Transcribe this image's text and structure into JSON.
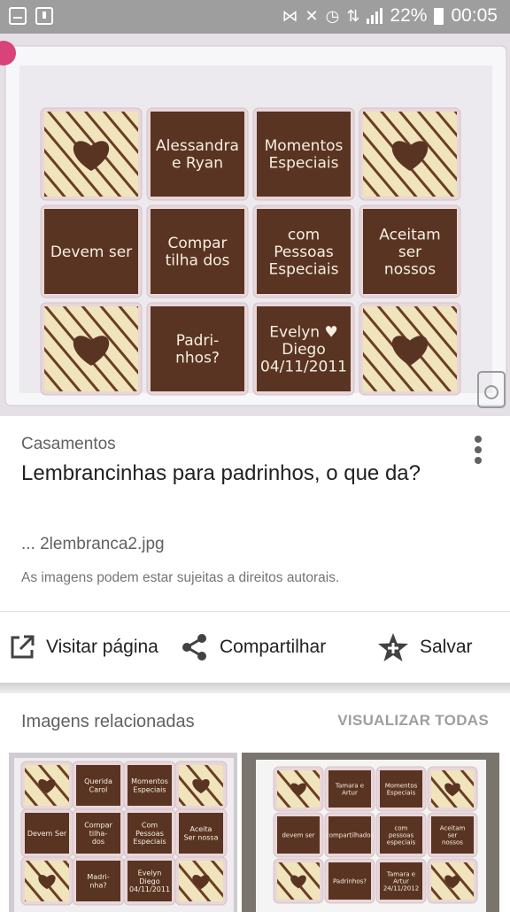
{
  "status_bar": {
    "battery_percent": "22%",
    "time": "00:05",
    "icons": [
      "screenshot-icon",
      "download-icon",
      "nfc-icon",
      "mute-icon",
      "alarm-icon",
      "data-icon",
      "signal-icon",
      "battery-icon"
    ]
  },
  "result": {
    "source": "Casamentos",
    "title": "Lembrancinhas para padrinhos, o que da?",
    "filename": "... 2lembranca2.jpg",
    "copyright": "As imagens podem estar sujeitas a direitos autorais."
  },
  "actions": {
    "visit": "Visitar página",
    "share": "Compartilhar",
    "save": "Salvar"
  },
  "related": {
    "title": "Imagens relacionadas",
    "view_all": "VISUALIZAR TODAS"
  },
  "hero_image": {
    "description_icon": "photo",
    "chocolate_texts": [
      [
        "",
        "Alessandra e Ryan",
        "Momentos Especiais",
        ""
      ],
      [
        "Devem ser",
        "Compar tilha dos",
        "com Pessoas Especiais",
        "Aceitam ser nossos"
      ],
      [
        "",
        "Padri- nhos?",
        "Evelyn ♥ Diego 04/11/2011",
        ""
      ]
    ]
  },
  "thumb1_texts": [
    [
      "",
      "Querida Carol",
      "Momentos Especiais",
      ""
    ],
    [
      "Devem Ser",
      "Compar tilha- dos",
      "Com Pessoas Especiais",
      "Aceita Ser nossa"
    ],
    [
      "",
      "Madri- nha?",
      "Evelyn Diego 04/11/2011",
      ""
    ]
  ],
  "thumb2_texts": [
    [
      "",
      "Tamara e Artur",
      "Momentos Especiais",
      ""
    ],
    [
      "devem ser",
      "compartilhados",
      "com pessoas especiais",
      "Aceitam ser nossos"
    ],
    [
      "",
      "Padrinhos?",
      "Tamara e Artur 24/11/2012",
      ""
    ]
  ],
  "colors": {
    "status_bar": "#9e9e9e",
    "chocolate": "#5a3422",
    "white_choc": "#f2e6c0",
    "wrapper": "#e6d4d8"
  }
}
